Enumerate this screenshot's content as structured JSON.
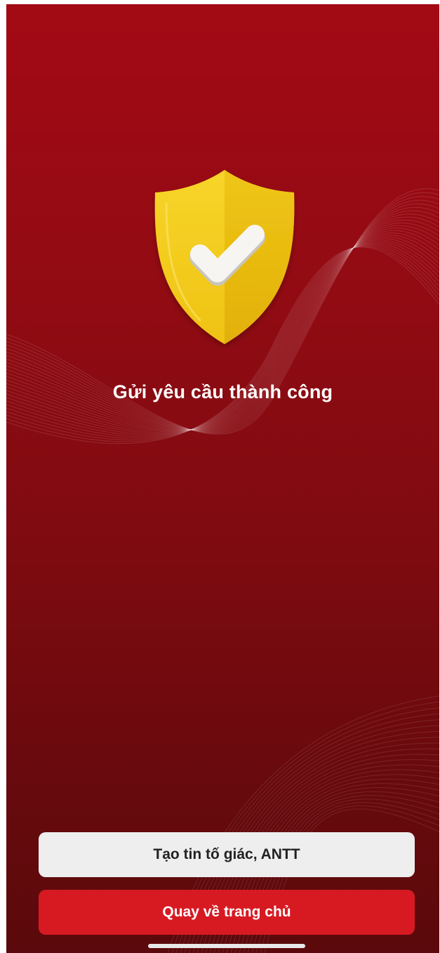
{
  "message": {
    "title": "Gửi yêu cầu thành công"
  },
  "actions": {
    "report_label": "Tạo tin tố giác, ANTT",
    "home_label": "Quay về trang chủ"
  },
  "icons": {
    "status": "shield-check-icon"
  },
  "colors": {
    "background": "#920b13",
    "primary_button": "#d71a22",
    "secondary_button": "#eeeeee",
    "shield": "#f5cf1c"
  }
}
